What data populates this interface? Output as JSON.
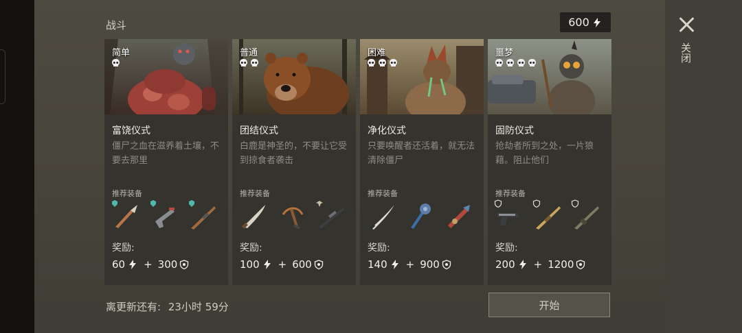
{
  "header": {
    "title": "战斗",
    "currency_amount": "600",
    "currency_icon": "energy-bolt-icon"
  },
  "close": {
    "label": "关闭"
  },
  "labels": {
    "recommended": "推荐装备",
    "reward": "奖励:",
    "plus": "+"
  },
  "cards": [
    {
      "difficulty": "简单",
      "skulls": 1,
      "name": "富饶仪式",
      "description": "僵尸之血在滋养着土壤，不要去那里",
      "equipment": [
        "dagger",
        "pistol",
        "rifle"
      ],
      "equipment_badge": "clan-badge-icon",
      "reward_energy": "60",
      "reward_points": "300"
    },
    {
      "difficulty": "普通",
      "skulls": 2,
      "name": "团结仪式",
      "description": "白鹿是神圣的，不要让它受到掠食者袭击",
      "equipment": [
        "machete",
        "crossbow",
        "sniper-rifle"
      ],
      "equipment_badge": "wing-badge-icon",
      "reward_energy": "100",
      "reward_points": "600"
    },
    {
      "difficulty": "困难",
      "skulls": 3,
      "name": "净化仪式",
      "description": "只要唤醒者还活着，就无法清除僵尸",
      "equipment": [
        "katana",
        "mace",
        "flamethrower"
      ],
      "equipment_badge": "none",
      "reward_energy": "140",
      "reward_points": "900"
    },
    {
      "difficulty": "噩梦",
      "skulls": 4,
      "name": "固防仪式",
      "description": "抢劫者所到之处，一片狼藉。阻止他们",
      "equipment": [
        "heavy-pistol",
        "shotgun",
        "assault-rifle"
      ],
      "equipment_badge": "shield-badge-icon",
      "reward_energy": "200",
      "reward_points": "1200"
    }
  ],
  "footer": {
    "timer_label": "离更新还有:",
    "timer_value": "23小时 59分",
    "start_label": "开始"
  },
  "colors": {
    "panel": "#4a473e",
    "card": "#34332d",
    "accent_teal": "#4fb8ad"
  }
}
